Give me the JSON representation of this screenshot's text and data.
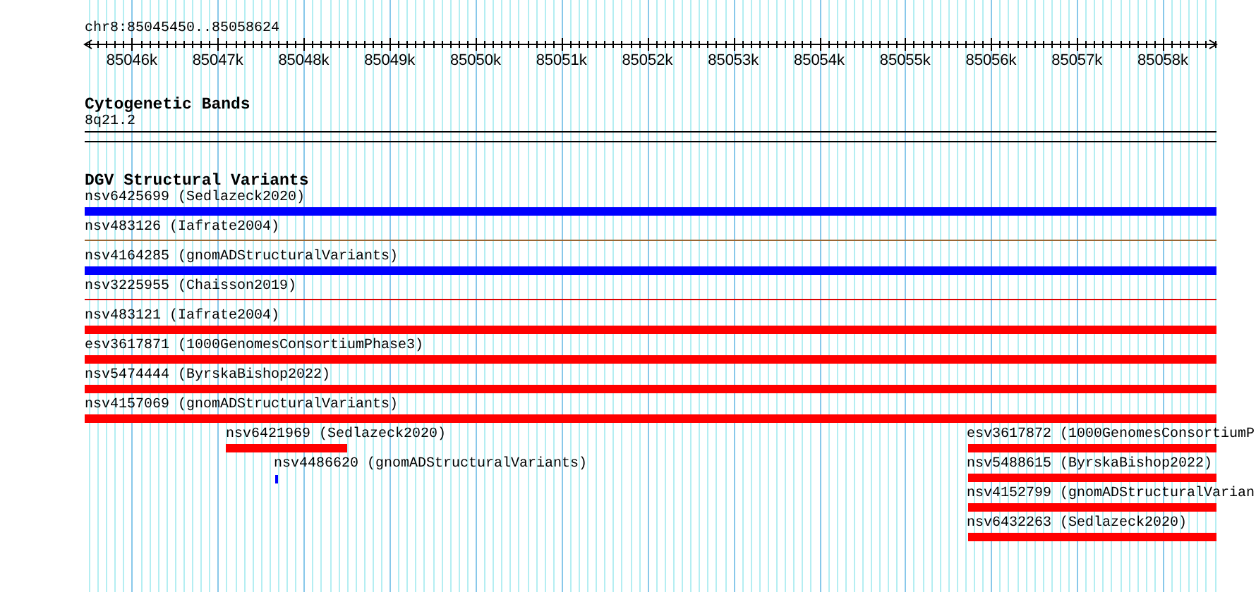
{
  "position": "chr8:85045450..85058624",
  "ruler": {
    "ticks": [
      "85046k",
      "85047k",
      "85048k",
      "85049k",
      "85050k",
      "85051k",
      "85052k",
      "85053k",
      "85054k",
      "85055k",
      "85056k",
      "85057k",
      "85058k"
    ]
  },
  "cytoband_track": {
    "title": "Cytogenetic Bands",
    "band": "8q21.2"
  },
  "dgv_track": {
    "title": "DGV Structural Variants",
    "rows": [
      {
        "features": [
          {
            "label": "nsv6425699 (Sedlazeck2020)",
            "color": "#0000ff",
            "kind": "thick"
          }
        ]
      },
      {
        "features": [
          {
            "label": "nsv483126 (Iafrate2004)",
            "color": "#996633",
            "kind": "thin"
          }
        ]
      },
      {
        "features": [
          {
            "label": "nsv4164285 (gnomADStructuralVariants)",
            "color": "#0000ff",
            "kind": "thick"
          }
        ]
      },
      {
        "features": [
          {
            "label": "nsv3225955 (Chaisson2019)",
            "color": "#dd0000",
            "kind": "thin"
          }
        ]
      },
      {
        "features": [
          {
            "label": "nsv483121 (Iafrate2004)",
            "color": "#ff0000",
            "kind": "thick"
          }
        ]
      },
      {
        "features": [
          {
            "label": "esv3617871 (1000GenomesConsortiumPhase3)",
            "color": "#ff0000",
            "kind": "thick"
          }
        ]
      },
      {
        "features": [
          {
            "label": "nsv5474444 (ByrskaBishop2022)",
            "color": "#ff0000",
            "kind": "thick"
          }
        ]
      },
      {
        "features": [
          {
            "label": "nsv4157069 (gnomADStructuralVariants)",
            "color": "#ff0000",
            "kind": "thick"
          }
        ]
      },
      {
        "features": [
          {
            "label": "nsv6421969 (Sedlazeck2020)",
            "color": "#ff0000",
            "kind": "thick"
          },
          {
            "label": "esv3617872 (1000GenomesConsortiumP",
            "color": "#ff0000",
            "kind": "thick"
          }
        ]
      },
      {
        "features": [
          {
            "label": "nsv4486620 (gnomADStructuralVariants)",
            "color": "#0000ff",
            "kind": "tick"
          },
          {
            "label": "nsv5488615 (ByrskaBishop2022)",
            "color": "#ff0000",
            "kind": "thick"
          }
        ]
      },
      {
        "features": [
          {
            "label": "nsv4152799 (gnomADStructuralVarian",
            "color": "#ff0000",
            "kind": "thick"
          }
        ]
      },
      {
        "features": [
          {
            "label": "nsv6432263 (Sedlazeck2020)",
            "color": "#ff0000",
            "kind": "thick"
          }
        ]
      }
    ]
  }
}
